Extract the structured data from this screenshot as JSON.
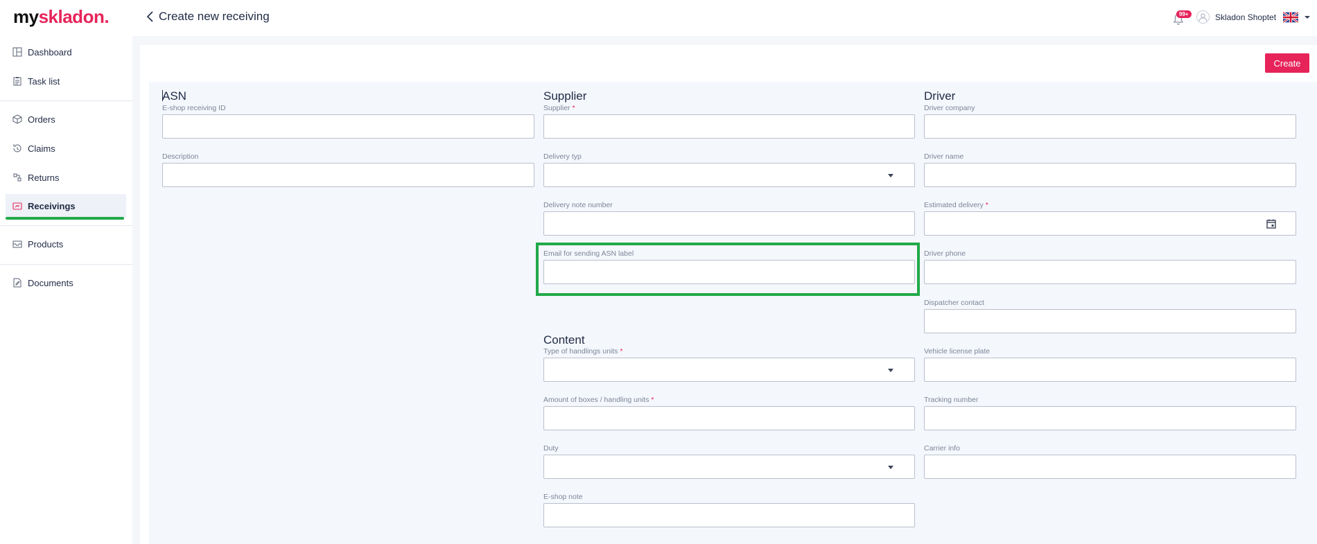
{
  "header": {
    "logo_prefix": "my",
    "logo_brand": "skladon",
    "logo_suffix": ".",
    "title": "Create new receiving",
    "notification_badge": "99+",
    "user_name": "Skladon Shoptet"
  },
  "sidebar": {
    "items": [
      {
        "label": "Dashboard",
        "icon": "dashboard-icon"
      },
      {
        "label": "Task list",
        "icon": "clipboard-icon"
      },
      {
        "label": "Orders",
        "icon": "box-icon"
      },
      {
        "label": "Claims",
        "icon": "claims-icon"
      },
      {
        "label": "Returns",
        "icon": "returns-icon"
      },
      {
        "label": "Receivings",
        "icon": "receiving-icon"
      },
      {
        "label": "Products",
        "icon": "inbox-icon"
      },
      {
        "label": "Documents",
        "icon": "document-icon"
      }
    ],
    "active": "Receivings"
  },
  "actions": {
    "create_label": "Create"
  },
  "sections": {
    "asn": "ASN",
    "supplier": "Supplier",
    "driver": "Driver",
    "content": "Content"
  },
  "fields": {
    "eshop_receiving_id": {
      "label": "E-shop receiving ID",
      "value": ""
    },
    "description": {
      "label": "Description",
      "value": ""
    },
    "supplier": {
      "label": "Supplier",
      "required": "*",
      "value": ""
    },
    "delivery_type": {
      "label": "Delivery typ",
      "value": ""
    },
    "delivery_note_number": {
      "label": "Delivery note number",
      "value": ""
    },
    "email_asn_label": {
      "label": "Email for sending ASN label",
      "value": ""
    },
    "type_handling_units": {
      "label": "Type of handlings units",
      "required": "*",
      "value": ""
    },
    "amount_boxes": {
      "label": "Amount of boxes / handling units",
      "required": "*",
      "value": ""
    },
    "duty": {
      "label": "Duty",
      "value": ""
    },
    "eshop_note": {
      "label": "E-shop note",
      "value": ""
    },
    "driver_company": {
      "label": "Driver company",
      "value": ""
    },
    "driver_name": {
      "label": "Driver name",
      "value": ""
    },
    "estimated_delivery": {
      "label": "Estimated delivery",
      "required": "*",
      "value": ""
    },
    "driver_phone": {
      "label": "Driver phone",
      "value": ""
    },
    "dispatcher_contact": {
      "label": "Dispatcher contact",
      "value": ""
    },
    "vehicle_license_plate": {
      "label": "Vehicle license plate",
      "value": ""
    },
    "tracking_number": {
      "label": "Tracking number",
      "value": ""
    },
    "carrier_info": {
      "label": "Carrier info",
      "value": ""
    }
  },
  "colors": {
    "brand": "#e6245a",
    "highlight": "#22a94a"
  }
}
